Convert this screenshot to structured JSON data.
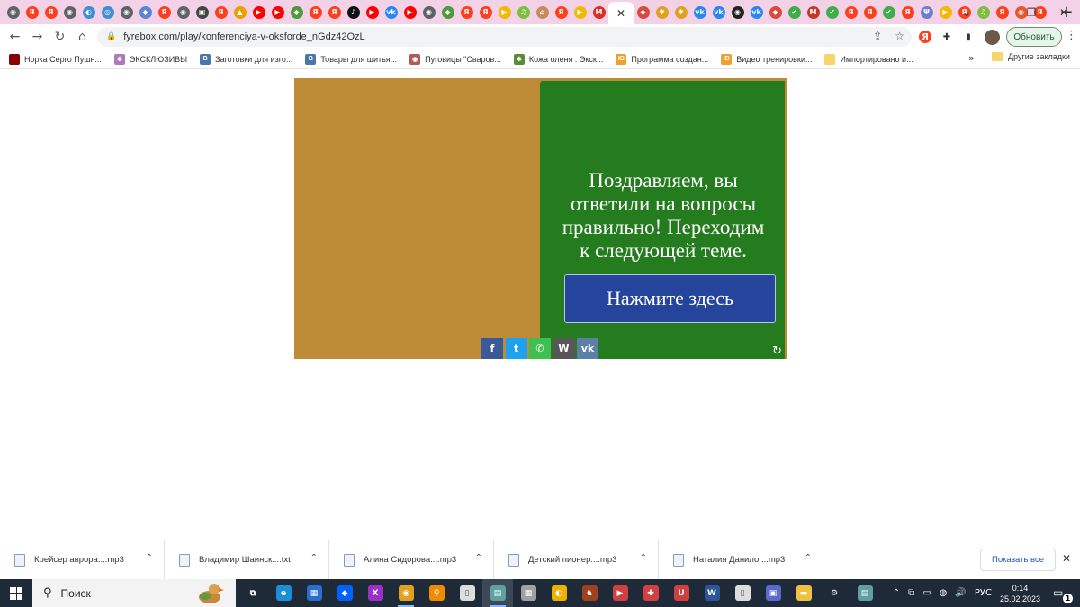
{
  "browser": {
    "tab_favicons": [
      {
        "icon": "chrome-icon",
        "glyph": "◉",
        "color": "#5f6368"
      },
      {
        "icon": "yandex-icon",
        "glyph": "Я",
        "color": "#fc3f1d"
      },
      {
        "icon": "yandex-icon",
        "glyph": "Я",
        "color": "#fc3f1d"
      },
      {
        "icon": "globe-icon",
        "glyph": "◉",
        "color": "#5f6368"
      },
      {
        "icon": "app-icon",
        "glyph": "◐",
        "color": "#3d8fd8"
      },
      {
        "icon": "app-icon",
        "glyph": "◎",
        "color": "#3d8fd8"
      },
      {
        "icon": "globe-icon",
        "glyph": "◉",
        "color": "#5f6368"
      },
      {
        "icon": "diamond-icon",
        "glyph": "◆",
        "color": "#5b84d6"
      },
      {
        "icon": "yandex-icon",
        "glyph": "Я",
        "color": "#fc3f1d"
      },
      {
        "icon": "globe-icon",
        "glyph": "◉",
        "color": "#5f6368"
      },
      {
        "icon": "app-icon",
        "glyph": "▣",
        "color": "#444444"
      },
      {
        "icon": "yandex-icon",
        "glyph": "Я",
        "color": "#fc3f1d"
      },
      {
        "icon": "app-icon",
        "glyph": "▲",
        "color": "#e8a100"
      },
      {
        "icon": "youtube-icon",
        "glyph": "▶",
        "color": "#ff0000"
      },
      {
        "icon": "youtube-icon",
        "glyph": "▶",
        "color": "#ff0000"
      },
      {
        "icon": "shield-icon",
        "glyph": "◆",
        "color": "#4a9c3e"
      },
      {
        "icon": "yandex-icon",
        "glyph": "Я",
        "color": "#fc3f1d"
      },
      {
        "icon": "yandex-icon",
        "glyph": "Я",
        "color": "#fc3f1d"
      },
      {
        "icon": "tiktok-icon",
        "glyph": "♪",
        "color": "#111111"
      },
      {
        "icon": "youtube-icon",
        "glyph": "▶",
        "color": "#ff0000"
      },
      {
        "icon": "vk-icon",
        "glyph": "vk",
        "color": "#2787f5"
      },
      {
        "icon": "youtube-icon",
        "glyph": "▶",
        "color": "#ff0000"
      },
      {
        "icon": "globe-icon",
        "glyph": "◉",
        "color": "#5f6368"
      },
      {
        "icon": "shield-icon",
        "glyph": "◆",
        "color": "#4a9c3e"
      },
      {
        "icon": "yandex-icon",
        "glyph": "Я",
        "color": "#fc3f1d"
      },
      {
        "icon": "yandex-icon",
        "glyph": "Я",
        "color": "#fc3f1d"
      },
      {
        "icon": "play-icon",
        "glyph": "▶",
        "color": "#f5b800"
      },
      {
        "icon": "music-icon",
        "glyph": "♫",
        "color": "#7fbf3f"
      },
      {
        "icon": "house-icon",
        "glyph": "⌂",
        "color": "#c78c5a"
      },
      {
        "icon": "yandex-icon",
        "glyph": "Я",
        "color": "#fc3f1d"
      },
      {
        "icon": "play-icon",
        "glyph": "▶",
        "color": "#f5b800"
      },
      {
        "icon": "gmail-icon",
        "glyph": "M",
        "color": "#d93025"
      }
    ],
    "active_tab_close": "✕",
    "tab_favicons_after": [
      {
        "icon": "app-icon",
        "glyph": "◆",
        "color": "#d94a3a"
      },
      {
        "icon": "butterfly-icon",
        "glyph": "✱",
        "color": "#e0a020"
      },
      {
        "icon": "butterfly-icon",
        "glyph": "✱",
        "color": "#e0a020"
      },
      {
        "icon": "vk-icon",
        "glyph": "vk",
        "color": "#2787f5"
      },
      {
        "icon": "vk-icon",
        "glyph": "vk",
        "color": "#2787f5"
      },
      {
        "icon": "panda-icon",
        "glyph": "◉",
        "color": "#222222"
      },
      {
        "icon": "vk-icon",
        "glyph": "vk",
        "color": "#2787f5"
      },
      {
        "icon": "app-icon",
        "glyph": "◆",
        "color": "#d94a3a"
      },
      {
        "icon": "check-icon",
        "glyph": "✔",
        "color": "#3fae49"
      },
      {
        "icon": "app-icon",
        "glyph": "M",
        "color": "#c0392b"
      },
      {
        "icon": "check-icon",
        "glyph": "✔",
        "color": "#3fae49"
      },
      {
        "icon": "yandex-icon",
        "glyph": "Я",
        "color": "#fc3f1d"
      },
      {
        "icon": "yandex-icon",
        "glyph": "Я",
        "color": "#fc3f1d"
      },
      {
        "icon": "check-icon",
        "glyph": "✔",
        "color": "#3fae49"
      },
      {
        "icon": "yandex-icon",
        "glyph": "Я",
        "color": "#fc3f1d"
      },
      {
        "icon": "trident-icon",
        "glyph": "Ψ",
        "color": "#6a7fd0"
      },
      {
        "icon": "play-icon",
        "glyph": "▶",
        "color": "#f5b800"
      },
      {
        "icon": "yandex-icon",
        "glyph": "Я",
        "color": "#fc3f1d"
      },
      {
        "icon": "music-icon",
        "glyph": "♫",
        "color": "#7fbf3f"
      },
      {
        "icon": "yandex-icon",
        "glyph": "Я",
        "color": "#fc3f1d"
      },
      {
        "icon": "app-icon",
        "glyph": "◉",
        "color": "#e8562a"
      },
      {
        "icon": "yandex-icon",
        "glyph": "Я",
        "color": "#fc3f1d"
      }
    ],
    "new_tab": "+",
    "window_controls": {
      "menu": "⌄",
      "minimize": "—",
      "restore": "❐",
      "close": "✕"
    },
    "nav": {
      "back": "←",
      "forward": "→",
      "reload": "↻",
      "home": "⌂"
    },
    "url": "fyrebox.com/play/konferenciya-v-oksforde_nGdz42OzL",
    "lock_glyph": "🔒",
    "omnibox_right": {
      "share": "⇪",
      "star": "☆"
    },
    "extensions": [
      {
        "icon": "yandex-icon",
        "glyph": "Я",
        "color": "#fc3f1d"
      },
      {
        "icon": "puzzle-icon",
        "glyph": "✚",
        "color": "#333333"
      },
      {
        "icon": "sidebar-icon",
        "glyph": "▮",
        "color": "#333333"
      }
    ],
    "update_label": "Обновить",
    "kebab": "⋮"
  },
  "bookmarks": {
    "items": [
      {
        "label": "Норка Серго Пушн...",
        "icon": "mink-icon",
        "color": "#8b0000",
        "glyph": ""
      },
      {
        "label": "ЭКСКЛЮЗИВЫ",
        "icon": "butterfly-icon",
        "color": "#b07ab8",
        "glyph": "✱"
      },
      {
        "label": "Заготовки для изго...",
        "icon": "vk-icon",
        "color": "#4a76a8",
        "glyph": "B"
      },
      {
        "label": "Товары для шитья...",
        "icon": "vk-icon",
        "color": "#4a76a8",
        "glyph": "B"
      },
      {
        "label": "Пуговицы \"Сваров...",
        "icon": "eye-icon",
        "color": "#b05a5a",
        "glyph": "◉"
      },
      {
        "label": "Кожа оленя . Экск...",
        "icon": "butterfly-icon",
        "color": "#5a8c3a",
        "glyph": "✱"
      },
      {
        "label": "Программа создан...",
        "icon": "ib-icon",
        "color": "#f0a030",
        "glyph": "IB"
      },
      {
        "label": "Видео тренировки...",
        "icon": "ib-icon",
        "color": "#f0a030",
        "glyph": "IB"
      },
      {
        "label": "Импортировано и...",
        "icon": "folder-icon",
        "color": "#f5d66b",
        "glyph": ""
      }
    ],
    "more": "»",
    "other_label": "Другие закладки"
  },
  "game": {
    "message": "Поздравляем, вы ответили на вопросы правильно! Переходим к следующей теме.",
    "button_label": "Нажмите здесь",
    "reload_glyph": "↻",
    "share": [
      {
        "icon": "facebook-icon",
        "glyph": "f",
        "color": "#3b5998"
      },
      {
        "icon": "twitter-icon",
        "glyph": "t",
        "color": "#1da1f2"
      },
      {
        "icon": "whatsapp-icon",
        "glyph": "✆",
        "color": "#3fbf4f"
      },
      {
        "icon": "wordpress-icon",
        "glyph": "W",
        "color": "#575757"
      },
      {
        "icon": "vk-icon",
        "glyph": "vk",
        "color": "#5b7fa6"
      }
    ]
  },
  "downloads": {
    "items": [
      {
        "name": "Крейсер аврора....mp3"
      },
      {
        "name": "Владимир Шаинск....txt"
      },
      {
        "name": "Алина Сидорова....mp3"
      },
      {
        "name": "Детский пионер....mp3"
      },
      {
        "name": "Наталия Данило....mp3"
      }
    ],
    "chevron": "⌃",
    "show_all": "Показать все",
    "close": "✕"
  },
  "taskbar": {
    "search_icon": "⚲",
    "search_label": "Поиск",
    "apps": [
      {
        "icon": "task-view-icon",
        "glyph": "⧉",
        "color": "transparent"
      },
      {
        "icon": "edge-icon",
        "glyph": "e",
        "color": "#1a8fd8"
      },
      {
        "icon": "store-icon",
        "glyph": "▦",
        "color": "#2a6fd0"
      },
      {
        "icon": "dropbox-icon",
        "glyph": "◆",
        "color": "#0061fe"
      },
      {
        "icon": "x-app-icon",
        "glyph": "X",
        "color": "#9b30c8"
      },
      {
        "icon": "chrome-icon",
        "glyph": "◉",
        "color": "#e0a020"
      },
      {
        "icon": "search-app-icon",
        "glyph": "⚲",
        "color": "#f08a00"
      },
      {
        "icon": "file-icon",
        "glyph": "▯",
        "color": "#dddddd"
      },
      {
        "icon": "notebook-icon",
        "glyph": "▤",
        "color": "#5fa0a0"
      },
      {
        "icon": "archive-icon",
        "glyph": "▦",
        "color": "#a0a0a0"
      },
      {
        "icon": "media-icon",
        "glyph": "◐",
        "color": "#f0b000"
      },
      {
        "icon": "horse-icon",
        "glyph": "♞",
        "color": "#a04020"
      },
      {
        "icon": "video-icon",
        "glyph": "▶",
        "color": "#d04040"
      },
      {
        "icon": "puzzle-icon",
        "glyph": "✚",
        "color": "#d04040"
      },
      {
        "icon": "magnet-icon",
        "glyph": "U",
        "color": "#d04040"
      },
      {
        "icon": "word-icon",
        "glyph": "W",
        "color": "#2b579a"
      },
      {
        "icon": "file-icon",
        "glyph": "▯",
        "color": "#dddddd"
      },
      {
        "icon": "save-icon",
        "glyph": "▣",
        "color": "#5a6ad0"
      },
      {
        "icon": "explorer-icon",
        "glyph": "▬",
        "color": "#f0c040"
      },
      {
        "icon": "settings-icon",
        "glyph": "⚙",
        "color": "transparent"
      },
      {
        "icon": "notebook-icon",
        "glyph": "▤",
        "color": "#5fa0a0"
      }
    ],
    "tray": {
      "chevron": "⌃",
      "icons": [
        "⧉",
        "▭",
        "◍",
        "🔊"
      ],
      "lang": "РУС",
      "time": "0:14",
      "date": "25.02.2023",
      "notif_glyph": "▭",
      "notif_count": "1"
    }
  },
  "colors": {
    "game_bg": "#be8c37",
    "panel_bg": "#247c1f",
    "button_bg": "#25449c",
    "tabstrip_bg": "#f3d1e6"
  }
}
